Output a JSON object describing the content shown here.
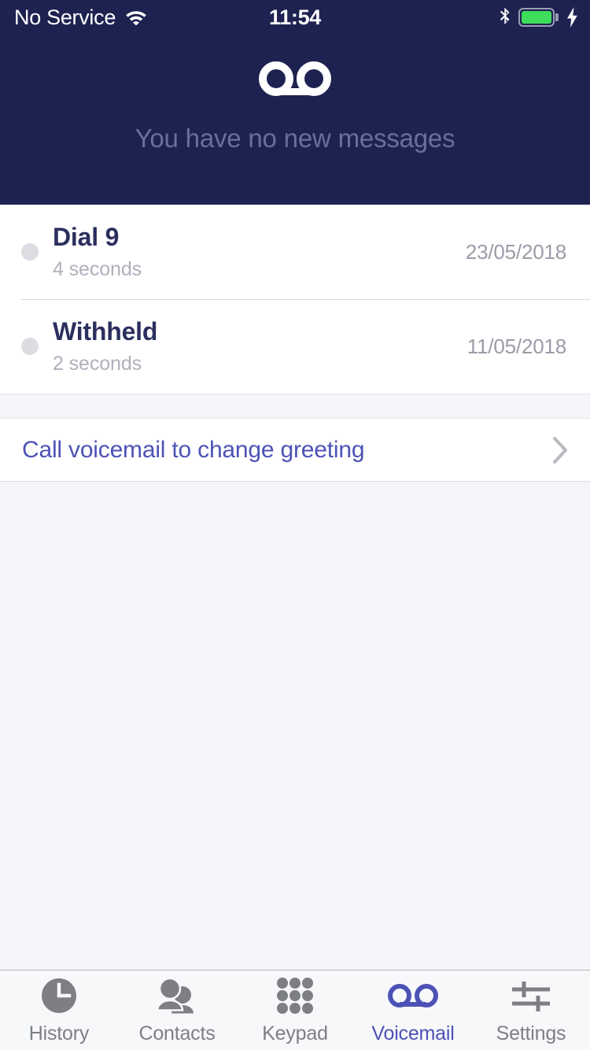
{
  "status_bar": {
    "carrier": "No Service",
    "time": "11:54",
    "wifi_icon": "wifi-icon",
    "bluetooth_icon": "bluetooth-icon",
    "battery_icon": "battery-full-icon",
    "charging_icon": "lightning-bolt-icon",
    "battery_color": "#3ddc5b"
  },
  "header": {
    "logo_icon": "voicemail-icon",
    "subtitle": "You have no new messages",
    "background_color": "#1e2250",
    "subtitle_color": "#6a6f9c"
  },
  "voicemails": [
    {
      "unread_dot": "unread-dot",
      "name": "Dial 9",
      "duration": "4 seconds",
      "date": "23/05/2018"
    },
    {
      "unread_dot": "unread-dot",
      "name": "Withheld",
      "duration": "2 seconds",
      "date": "11/05/2018"
    }
  ],
  "greeting": {
    "label": "Call voicemail to change greeting",
    "chevron_icon": "chevron-right-icon",
    "link_color": "#4c52b5"
  },
  "tabs": [
    {
      "label": "History",
      "icon": "clock-icon",
      "active": false
    },
    {
      "label": "Contacts",
      "icon": "contacts-icon",
      "active": false
    },
    {
      "label": "Keypad",
      "icon": "keypad-icon",
      "active": false
    },
    {
      "label": "Voicemail",
      "icon": "voicemail-icon",
      "active": true
    },
    {
      "label": "Settings",
      "icon": "sliders-icon",
      "active": false
    }
  ],
  "accent_color": "#4c52b5",
  "inactive_color": "#7d7f85"
}
